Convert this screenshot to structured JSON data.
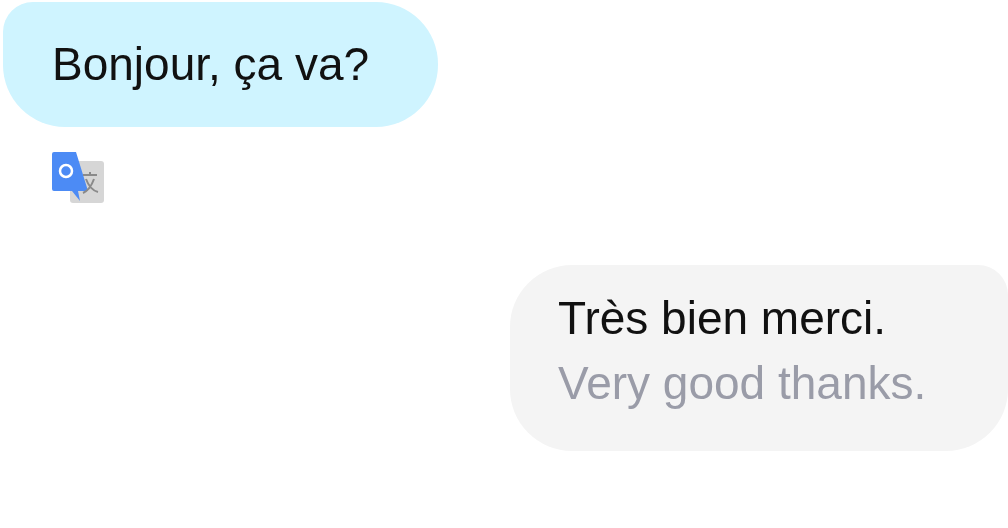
{
  "messages": [
    {
      "kind": "sent",
      "text": "Bonjour, ça va?",
      "translate_badge": true
    },
    {
      "kind": "received",
      "text": "Très bien merci.",
      "translation": "Very good thanks."
    }
  ]
}
